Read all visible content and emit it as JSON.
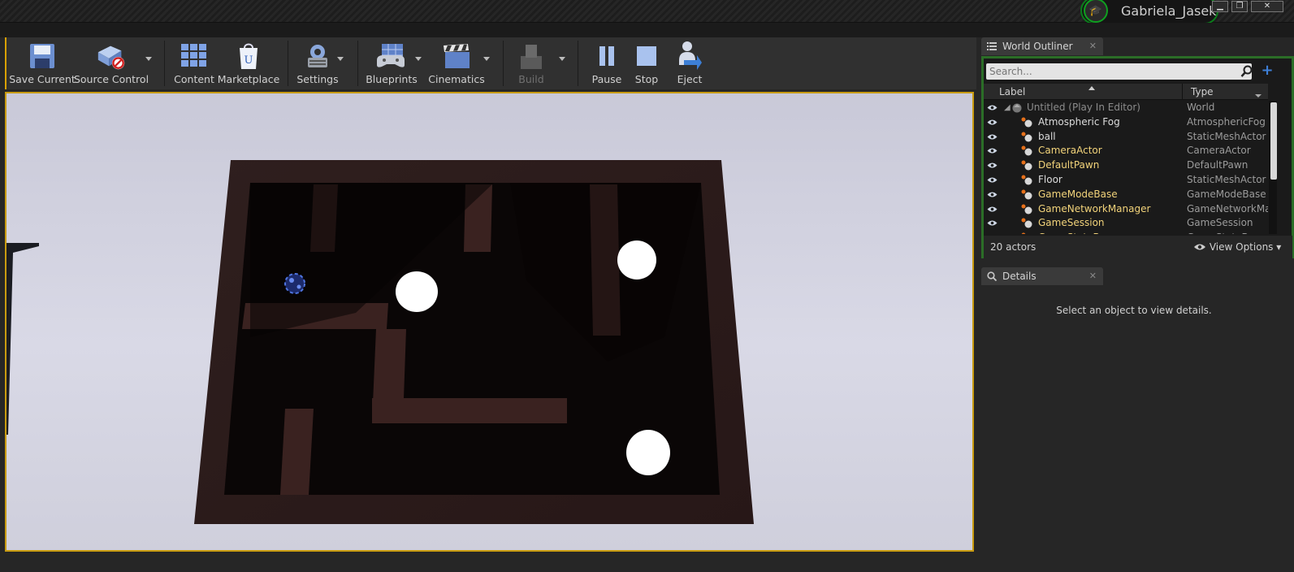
{
  "window": {
    "user_name": "Gabriela_Jasek",
    "minimize": "▁",
    "restore": "❐",
    "close": "✕"
  },
  "toolbar": {
    "items": [
      {
        "label": "Save Current",
        "icon": "save-icon"
      },
      {
        "label": "Source Control",
        "icon": "source-control-icon"
      },
      {
        "label": "Content",
        "icon": "content-browser-icon"
      },
      {
        "label": "Marketplace",
        "icon": "marketplace-icon"
      },
      {
        "label": "Settings",
        "icon": "settings-icon"
      },
      {
        "label": "Blueprints",
        "icon": "blueprints-icon"
      },
      {
        "label": "Cinematics",
        "icon": "cinematics-icon"
      },
      {
        "label": "Build",
        "icon": "build-icon",
        "disabled": true
      },
      {
        "label": "Pause",
        "icon": "pause-icon"
      },
      {
        "label": "Stop",
        "icon": "stop-icon"
      },
      {
        "label": "Eject",
        "icon": "eject-icon"
      }
    ]
  },
  "outliner": {
    "tab_label": "World Outliner",
    "search_placeholder": "Search...",
    "col_label": "Label",
    "col_type": "Type",
    "rows": [
      {
        "label": "Untitled (Play In Editor)",
        "type": "World",
        "kind": "world"
      },
      {
        "label": "Atmospheric Fog",
        "type": "AtmosphericFog",
        "kind": "normal"
      },
      {
        "label": "ball",
        "type": "StaticMeshActor",
        "kind": "normal"
      },
      {
        "label": "CameraActor",
        "type": "CameraActor",
        "kind": "yellow"
      },
      {
        "label": "DefaultPawn",
        "type": "DefaultPawn",
        "kind": "yellow"
      },
      {
        "label": "Floor",
        "type": "StaticMeshActor",
        "kind": "normal"
      },
      {
        "label": "GameModeBase",
        "type": "GameModeBase",
        "kind": "yellow"
      },
      {
        "label": "GameNetworkManager",
        "type": "GameNetworkMar",
        "kind": "yellow"
      },
      {
        "label": "GameSession",
        "type": "GameSession",
        "kind": "yellow"
      },
      {
        "label": "GameStateBase",
        "type": "GameStateBase",
        "kind": "yellow"
      }
    ],
    "actor_count": "20 actors",
    "view_options": "View Options"
  },
  "details": {
    "tab_label": "Details",
    "empty_message": "Select an object to view details."
  },
  "colors": {
    "accent_yellow": "#c89b10",
    "outliner_border": "#2b6d27",
    "actor_highlight": "#f2d37a"
  }
}
